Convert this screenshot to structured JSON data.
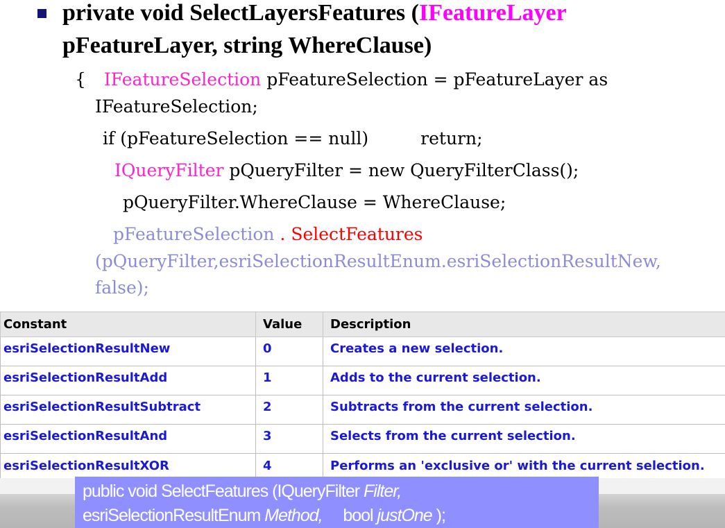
{
  "signature": {
    "line1_prefix": "private void SelectLayersFeatures (",
    "line1_type": "IFeatureLayer",
    "line2": "pFeatureLayer, string WhereClause)"
  },
  "code": {
    "brace": "{",
    "l1_type": "IFeatureSelection",
    "l1_rest": " pFeatureSelection = pFeatureLayer as",
    "l2": "IFeatureSelection;",
    "l3_a": "if (pFeatureSelection == null)",
    "l3_b": "return;",
    "l4_type": "IQueryFilter",
    "l4_rest": " pQueryFilter = new QueryFilterClass();",
    "l5": "pQueryFilter.WhereClause = WhereClause;",
    "l6_obj": "pFeatureSelection",
    "l6_dot": " . ",
    "l6_method": "SelectFeatures",
    "l7": "(pQueryFilter,esriSelectionResultEnum.esriSelectionResultNew,",
    "l8": "false);"
  },
  "table": {
    "headers": [
      "Constant",
      "Value",
      "Description"
    ],
    "rows": [
      {
        "constant": "esriSelectionResultNew",
        "value": "0",
        "description": "Creates a new selection."
      },
      {
        "constant": "esriSelectionResultAdd",
        "value": "1",
        "description": "Adds to the current selection."
      },
      {
        "constant": "esriSelectionResultSubtract",
        "value": "2",
        "description": "Subtracts from the current selection."
      },
      {
        "constant": "esriSelectionResultAnd",
        "value": "3",
        "description": "Selects from the current selection."
      },
      {
        "constant": "esriSelectionResultXOR",
        "value": "4",
        "description": "Performs an 'exclusive or' with the current selection."
      }
    ]
  },
  "callout": {
    "l1_a": "public void SelectFeatures (IQueryFilter ",
    "l1_param": "Filter,",
    "l2_type": "esriSelectionResultEnum ",
    "l2_param": "Method,",
    "l2_b": "     bool ",
    "l2_param2": "justOne",
    "l2_end": " );"
  },
  "colors": {
    "type_magenta": "#ff22cc",
    "faded_code": "#8c8cd6",
    "table_text": "#1a1ad6",
    "callout_bg": "#8f8fff"
  }
}
